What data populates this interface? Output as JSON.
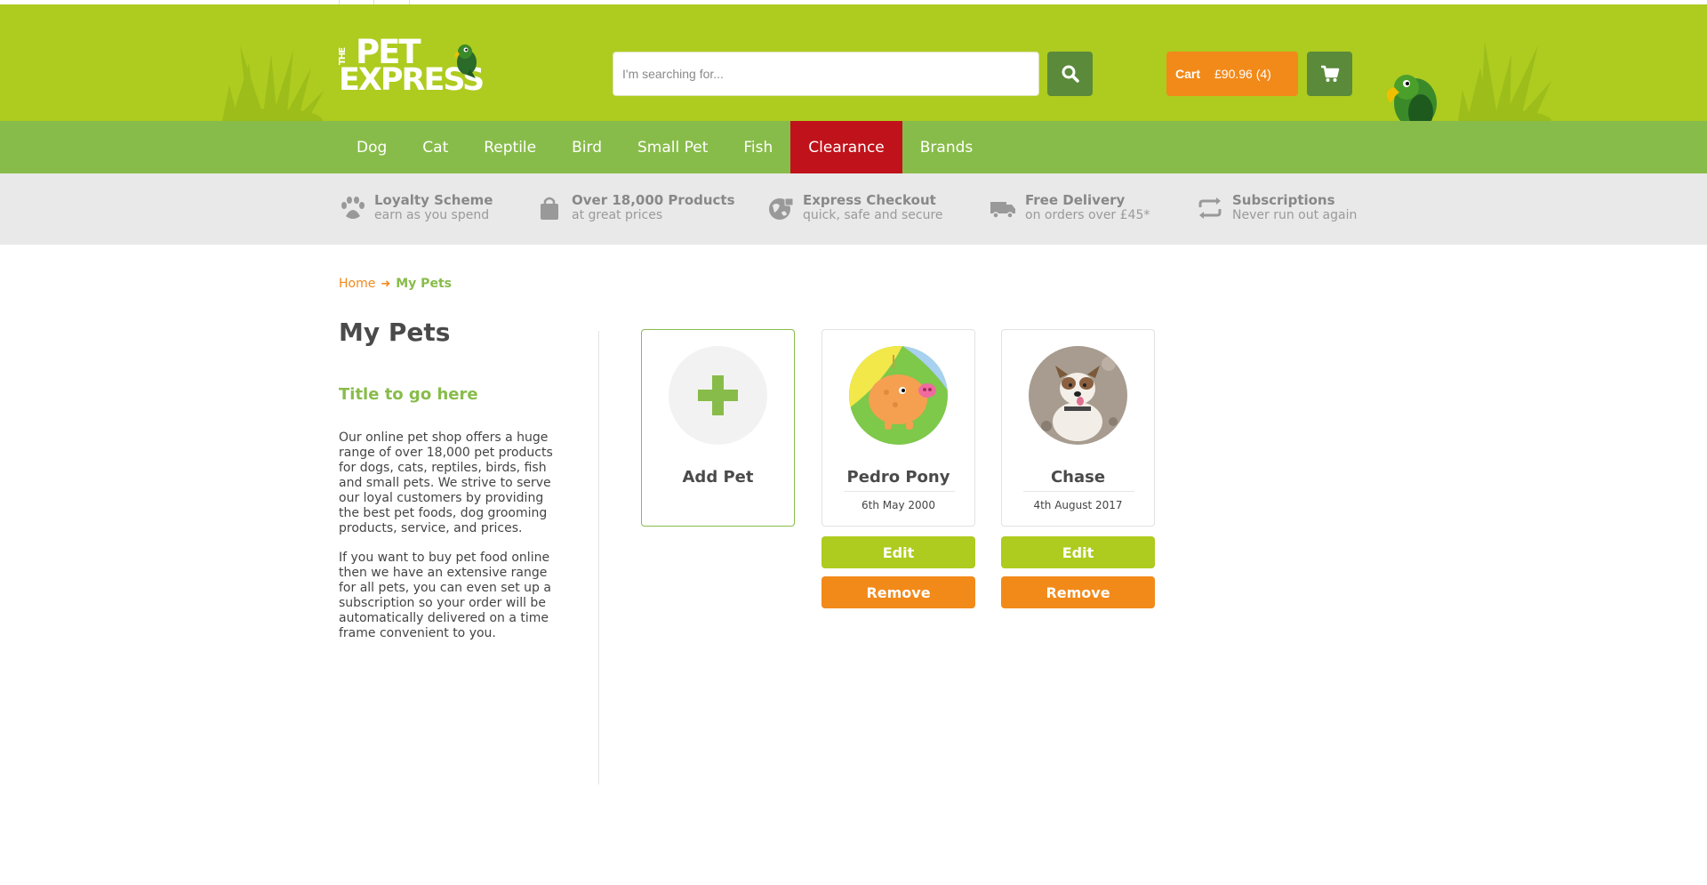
{
  "header": {
    "logo": {
      "the": "THE",
      "line1": "PET",
      "line2": "EXPRESS"
    },
    "search": {
      "placeholder": "I'm searching for..."
    },
    "cart": {
      "label": "Cart",
      "summary": "£90.96 (4)"
    }
  },
  "nav": {
    "items": [
      {
        "label": "Dog"
      },
      {
        "label": "Cat"
      },
      {
        "label": "Reptile"
      },
      {
        "label": "Bird"
      },
      {
        "label": "Small Pet"
      },
      {
        "label": "Fish"
      },
      {
        "label": "Clearance",
        "active": true
      },
      {
        "label": "Brands"
      }
    ]
  },
  "usps": [
    {
      "icon": "paw-icon",
      "title": "Loyalty Scheme",
      "subtitle": "earn as you spend"
    },
    {
      "icon": "shopping-bag-icon",
      "title": "Over 18,000 Products",
      "subtitle": "at great prices"
    },
    {
      "icon": "secure-globe-icon",
      "title": "Express Checkout",
      "subtitle": "quick, safe and secure"
    },
    {
      "icon": "truck-icon",
      "title": "Free Delivery",
      "subtitle": "on orders over £45*"
    },
    {
      "icon": "repeat-icon",
      "title": "Subscriptions",
      "subtitle": "Never run out again"
    }
  ],
  "breadcrumb": {
    "home": "Home",
    "current": "My Pets"
  },
  "sidebar": {
    "title": "My Pets",
    "subtitle": "Title to go here",
    "paragraph1": "Our online pet shop offers a huge range of over 18,000 pet products for dogs, cats, reptiles, birds, fish and small pets. We strive to serve our loyal customers by providing the best pet foods, dog grooming products, service, and prices.",
    "paragraph2": "If you want to buy pet food online then we have an extensive range for all pets, you can even set up a subscription so your order will be automatically delivered on a time frame convenient to you."
  },
  "pets": {
    "add_label": "Add Pet",
    "edit_label": "Edit",
    "remove_label": "Remove",
    "list": [
      {
        "name": "Pedro Pony",
        "dob": "6th May 2000",
        "avatar": "pig-illustration"
      },
      {
        "name": "Chase",
        "dob": "4th August 2017",
        "avatar": "dog-photo"
      }
    ]
  },
  "colors": {
    "header_green": "#aecb1f",
    "nav_green": "#88bc4a",
    "clearance_red": "#c0121a",
    "orange": "#f28a1a",
    "dark_green_button": "#5a8a3a"
  }
}
